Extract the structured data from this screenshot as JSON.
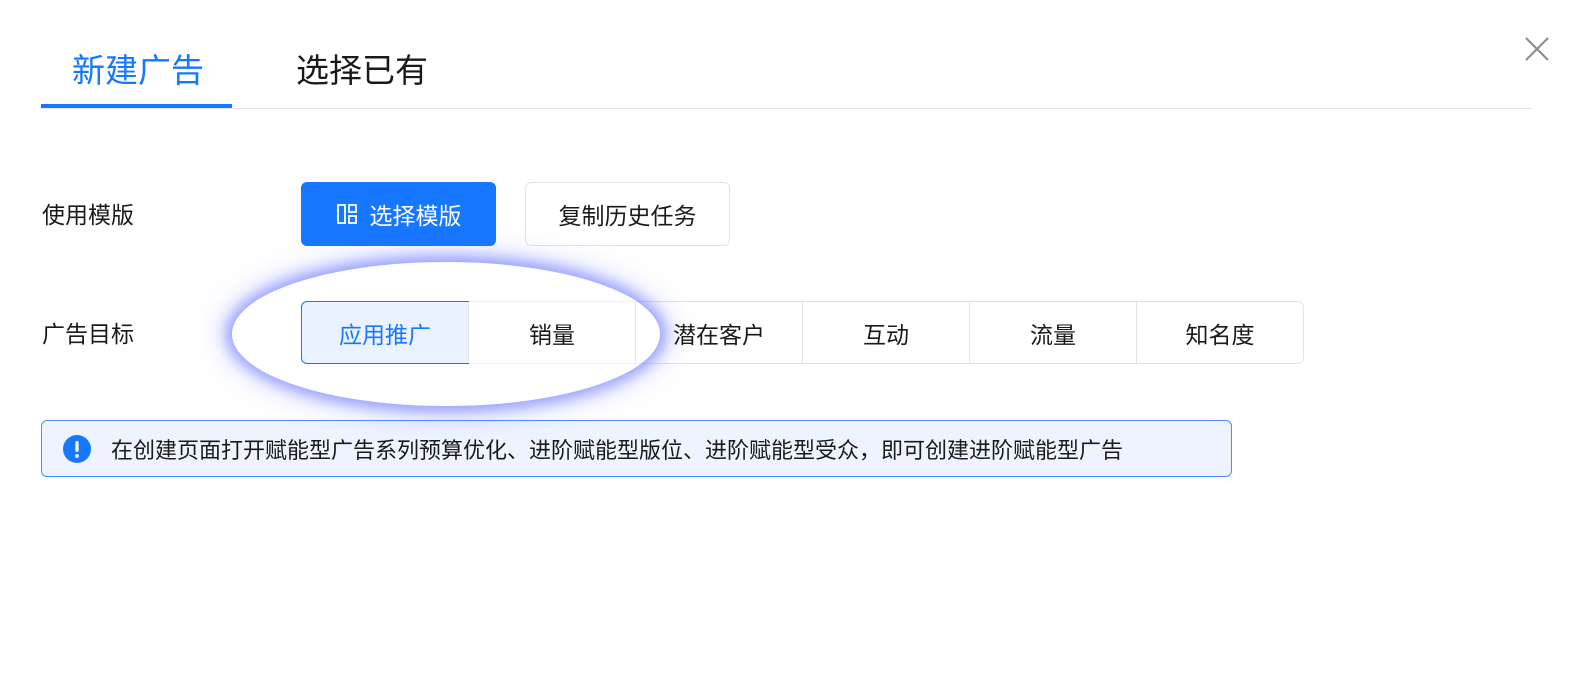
{
  "tabs": [
    {
      "label": "新建广告",
      "active": true
    },
    {
      "label": "选择已有",
      "active": false
    }
  ],
  "template_row": {
    "label": "使用模版",
    "select_template_label": "选择模版",
    "copy_history_label": "复制历史任务"
  },
  "goal_row": {
    "label": "广告目标",
    "options": [
      "应用推广",
      "销量",
      "潜在客户",
      "互动",
      "流量",
      "知名度"
    ],
    "selected": "应用推广"
  },
  "alert": {
    "text": "在创建页面打开赋能型广告系列预算优化、进阶赋能型版位、进阶赋能型受众，即可创建进阶赋能型广告"
  },
  "icons": {
    "close": "close-icon",
    "template": "layout-template-icon",
    "info": "exclamation-circle-icon"
  },
  "colors": {
    "accent": "#1677ff",
    "selected_bg": "#eaf2ff",
    "alert_bg": "#eef4ff",
    "highlight_glow": "#5866ff"
  }
}
